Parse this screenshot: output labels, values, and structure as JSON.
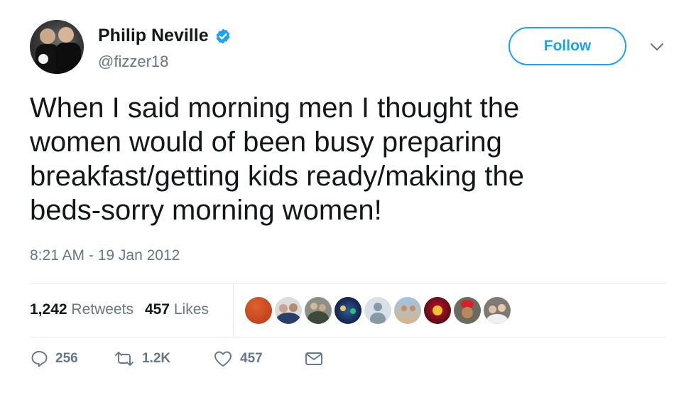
{
  "user": {
    "name": "Philip Neville",
    "handle": "@fizzer18",
    "avatar_icon": "profile-photo-two-players"
  },
  "header": {
    "follow_label": "Follow",
    "menu_icon": "chevron-down-icon"
  },
  "tweet": {
    "text": "When I said morning men I thought the\nwomen would of been busy preparing\nbreakfast/getting kids ready/making the\nbeds-sorry morning women!",
    "timestamp": "8:21 AM - 19 Jan 2012"
  },
  "stats": {
    "retweets_count": "1,242",
    "retweets_label": "Retweets",
    "likes_count": "457",
    "likes_label": "Likes"
  },
  "likers": [
    {
      "icon": "orange-avatar"
    },
    {
      "icon": "group-photo-avatar"
    },
    {
      "icon": "team-photo-avatar"
    },
    {
      "icon": "crowd-photo-avatar"
    },
    {
      "icon": "default-profile-avatar"
    },
    {
      "icon": "beach-photo-avatar"
    },
    {
      "icon": "club-crest-avatar"
    },
    {
      "icon": "santa-hat-avatar"
    },
    {
      "icon": "couple-photo-avatar"
    }
  ],
  "actions": {
    "reply_count": "256",
    "retweet_count": "1.2K",
    "like_count": "457",
    "reply_icon": "reply-icon",
    "retweet_icon": "retweet-icon",
    "like_icon": "heart-icon",
    "dm_icon": "envelope-icon"
  },
  "colors": {
    "accent": "#1da1f2",
    "secondary_text": "#657786",
    "primary_text": "#14171a",
    "divider": "#e6ecf0"
  }
}
